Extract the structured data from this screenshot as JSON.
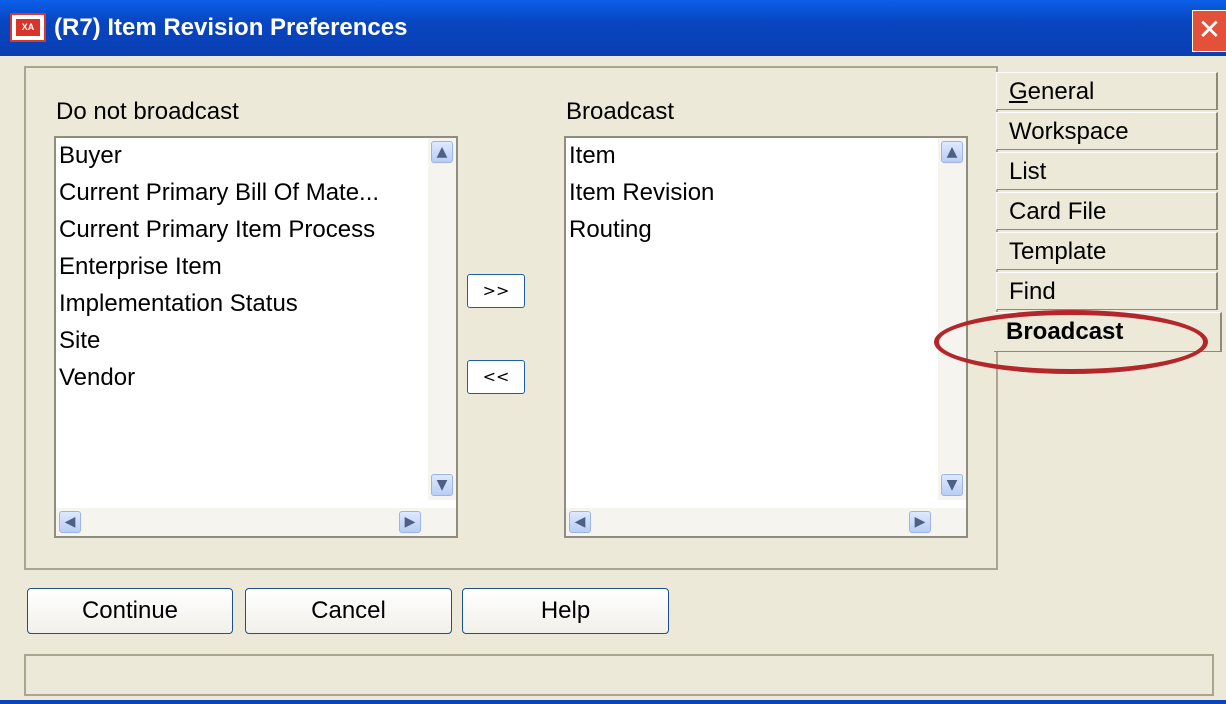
{
  "window": {
    "title": "(R7) Item Revision Preferences",
    "app_icon": "XA",
    "close_symbol": "✕"
  },
  "left_list": {
    "label": "Do not broadcast",
    "items": [
      "Buyer",
      "Current Primary Bill Of Mate...",
      "Current Primary Item Process",
      "Enterprise Item",
      "Implementation Status",
      "Site",
      "Vendor"
    ]
  },
  "right_list": {
    "label": "Broadcast",
    "items": [
      "Item",
      "Item Revision",
      "Routing"
    ]
  },
  "move_buttons": {
    "add": ">>",
    "remove": "<<"
  },
  "tabs": [
    {
      "first": "G",
      "rest": "eneral"
    },
    {
      "first": "",
      "rest": "Workspace"
    },
    {
      "first": "",
      "rest": "List"
    },
    {
      "first": "",
      "rest": "Card File"
    },
    {
      "first": "",
      "rest": "Template"
    },
    {
      "first": "",
      "rest": "Find"
    },
    {
      "first": "",
      "rest": "Broadcast"
    }
  ],
  "active_tab": "Broadcast",
  "buttons": {
    "continue": "Continue",
    "cancel": "Cancel",
    "help": "Help"
  },
  "scroll_arrows": {
    "up": "▲",
    "down": "▼",
    "left": "◀",
    "right": "▶"
  },
  "colors": {
    "titlebar": "#0A4FD6",
    "highlight_ellipse": "#B5262B",
    "dialog_bg": "#ECE9D8"
  }
}
